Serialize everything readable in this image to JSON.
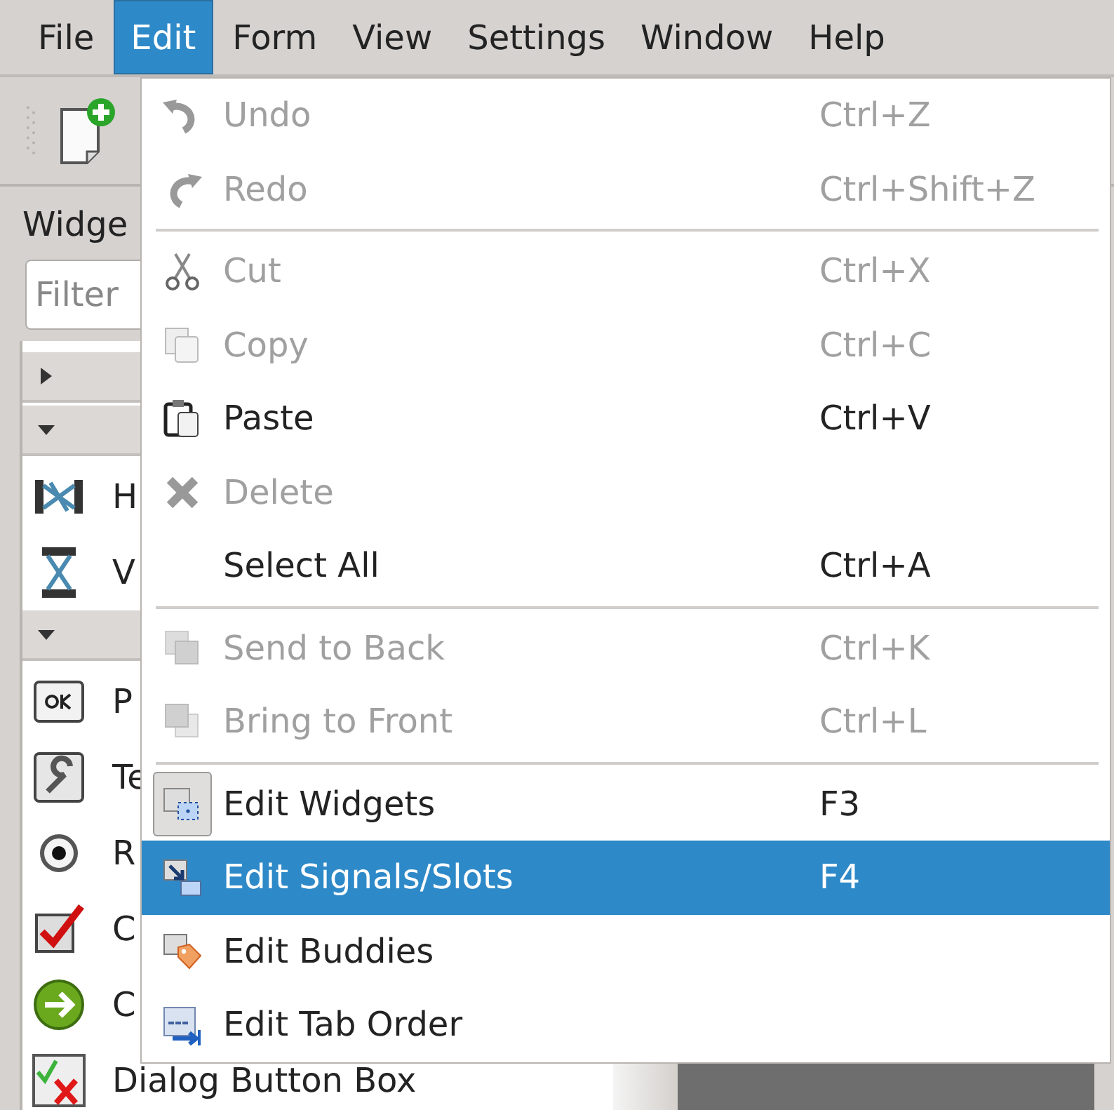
{
  "menubar": [
    {
      "label": "File",
      "selected": false
    },
    {
      "label": "Edit",
      "selected": true
    },
    {
      "label": "Form",
      "selected": false
    },
    {
      "label": "View",
      "selected": false
    },
    {
      "label": "Settings",
      "selected": false
    },
    {
      "label": "Window",
      "selected": false
    },
    {
      "label": "Help",
      "selected": false
    }
  ],
  "widget_box": {
    "title": "Widge",
    "filter": {
      "placeholder": "Filter"
    },
    "groups": [
      {
        "expanded": false
      },
      {
        "expanded": true,
        "items": [
          {
            "label": "H"
          },
          {
            "label": "V"
          }
        ]
      },
      {
        "expanded": true,
        "items": [
          {
            "label": "P"
          },
          {
            "label": "Te"
          },
          {
            "label": "R"
          },
          {
            "label": "C"
          },
          {
            "label": "C"
          },
          {
            "label": "Dialog Button Box"
          }
        ]
      }
    ]
  },
  "edit_menu": [
    {
      "kind": "item",
      "label": "Undo",
      "shortcut": "Ctrl+Z",
      "disabled": true,
      "checked": false,
      "selected": false
    },
    {
      "kind": "item",
      "label": "Redo",
      "shortcut": "Ctrl+Shift+Z",
      "disabled": true,
      "checked": false,
      "selected": false
    },
    {
      "kind": "separator"
    },
    {
      "kind": "item",
      "label": "Cut",
      "shortcut": "Ctrl+X",
      "disabled": true,
      "checked": false,
      "selected": false
    },
    {
      "kind": "item",
      "label": "Copy",
      "shortcut": "Ctrl+C",
      "disabled": true,
      "checked": false,
      "selected": false
    },
    {
      "kind": "item",
      "label": "Paste",
      "shortcut": "Ctrl+V",
      "disabled": false,
      "checked": false,
      "selected": false
    },
    {
      "kind": "item",
      "label": "Delete",
      "disabled": true,
      "checked": false,
      "selected": false
    },
    {
      "kind": "item",
      "label": "Select All",
      "shortcut": "Ctrl+A",
      "disabled": false,
      "checked": false,
      "selected": false
    },
    {
      "kind": "separator"
    },
    {
      "kind": "item",
      "label": "Send to Back",
      "shortcut": "Ctrl+K",
      "disabled": true,
      "checked": false,
      "selected": false
    },
    {
      "kind": "item",
      "label": "Bring to Front",
      "shortcut": "Ctrl+L",
      "disabled": true,
      "checked": false,
      "selected": false
    },
    {
      "kind": "separator"
    },
    {
      "kind": "item",
      "label": "Edit Widgets",
      "shortcut": "F3",
      "disabled": false,
      "checked": true,
      "selected": false
    },
    {
      "kind": "item",
      "label": "Edit Signals/Slots",
      "shortcut": "F4",
      "disabled": false,
      "checked": false,
      "selected": true
    },
    {
      "kind": "item",
      "label": "Edit Buddies",
      "disabled": false,
      "checked": false,
      "selected": false
    },
    {
      "kind": "item",
      "label": "Edit Tab Order",
      "disabled": false,
      "checked": false,
      "selected": false
    }
  ]
}
